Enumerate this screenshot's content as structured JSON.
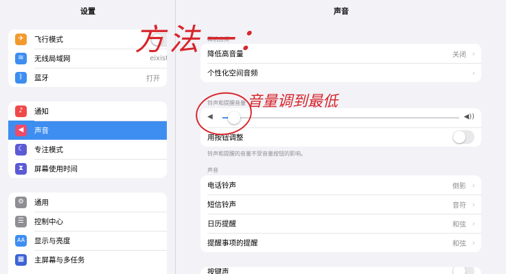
{
  "sidebar": {
    "title": "设置",
    "groups": [
      {
        "items": [
          {
            "label": "飞行模式",
            "icon": "airplane-icon",
            "glyph": "✈",
            "color": "#f29a2e",
            "value": "",
            "toggle": true
          },
          {
            "label": "无线局域网",
            "icon": "wifi-icon",
            "glyph": "≋",
            "color": "#3d8ef0",
            "value": "eixist"
          },
          {
            "label": "蓝牙",
            "icon": "bluetooth-icon",
            "glyph": "ᛒ",
            "color": "#3d8ef0",
            "value": "打开"
          }
        ]
      },
      {
        "items": [
          {
            "label": "通知",
            "icon": "bell-icon",
            "glyph": "🔔",
            "color": "#ef4a4a"
          },
          {
            "label": "声音",
            "icon": "speaker-icon",
            "glyph": "🔊",
            "color": "#ef4a6a",
            "selected": true
          },
          {
            "label": "专注模式",
            "icon": "moon-icon",
            "glyph": "☾",
            "color": "#5b5bd6"
          },
          {
            "label": "屏幕使用时间",
            "icon": "hourglass-icon",
            "glyph": "⧗",
            "color": "#5b5bd6"
          }
        ]
      },
      {
        "items": [
          {
            "label": "通用",
            "icon": "gear-icon",
            "glyph": "⚙",
            "color": "#8e8e93"
          },
          {
            "label": "控制中心",
            "icon": "switches-icon",
            "glyph": "☰",
            "color": "#8e8e93"
          },
          {
            "label": "显示与亮度",
            "icon": "text-size-icon",
            "glyph": "AA",
            "color": "#3d8ef0"
          },
          {
            "label": "主屏幕与多任务",
            "icon": "grid-icon",
            "glyph": "▦",
            "color": "#3d64d6"
          }
        ]
      }
    ]
  },
  "content": {
    "title": "声音",
    "group1_header": "耳机音频",
    "group1": [
      {
        "label": "降低高音量",
        "value": "关闭"
      },
      {
        "label": "个性化空间音频",
        "value": ""
      }
    ],
    "ringer_header": "铃声和提醒音量",
    "ringer": {
      "level": 0.05,
      "button_adjust_label": "用按钮调整"
    },
    "ringer_footer": "铃声和提醒的音量不受音量按钮的影响。",
    "sounds_header": "声音",
    "sounds": [
      {
        "label": "电话铃声",
        "value": "倒影"
      },
      {
        "label": "短信铃声",
        "value": "音符"
      },
      {
        "label": "日历提醒",
        "value": "和弦"
      },
      {
        "label": "提醒事项的提醒",
        "value": "和弦"
      }
    ],
    "bottom_row_label": "按键声"
  },
  "annotation": {
    "method_text": "方法一：",
    "volume_text": "音量调到最低",
    "color": "#d7262b"
  }
}
